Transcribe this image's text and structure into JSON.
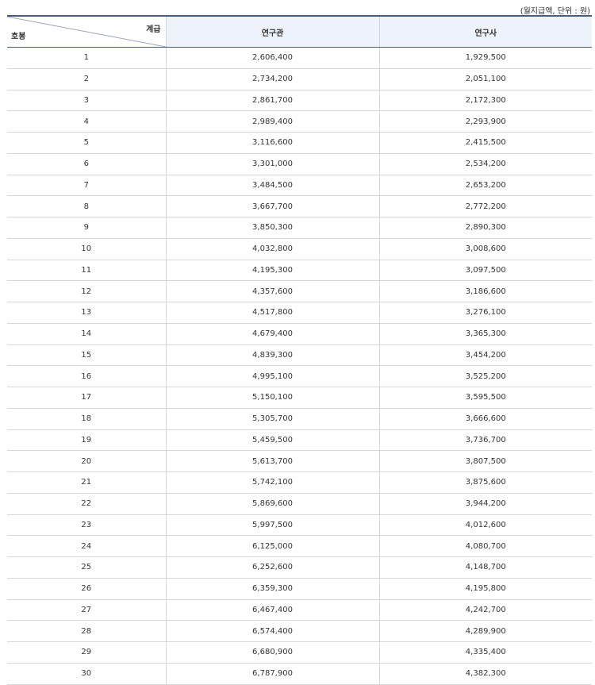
{
  "caption_fragment": "",
  "unit_note": "(월지급액, 단위 : 원)",
  "header": {
    "grade_label": "계급",
    "step_label": "호봉",
    "columns": [
      "연구관",
      "연구사"
    ]
  },
  "rows": [
    {
      "step": "1",
      "researcher_senior": "2,606,400",
      "researcher": "1,929,500"
    },
    {
      "step": "2",
      "researcher_senior": "2,734,200",
      "researcher": "2,051,100"
    },
    {
      "step": "3",
      "researcher_senior": "2,861,700",
      "researcher": "2,172,300"
    },
    {
      "step": "4",
      "researcher_senior": "2,989,400",
      "researcher": "2,293,900"
    },
    {
      "step": "5",
      "researcher_senior": "3,116,600",
      "researcher": "2,415,500"
    },
    {
      "step": "6",
      "researcher_senior": "3,301,000",
      "researcher": "2,534,200"
    },
    {
      "step": "7",
      "researcher_senior": "3,484,500",
      "researcher": "2,653,200"
    },
    {
      "step": "8",
      "researcher_senior": "3,667,700",
      "researcher": "2,772,200"
    },
    {
      "step": "9",
      "researcher_senior": "3,850,300",
      "researcher": "2,890,300"
    },
    {
      "step": "10",
      "researcher_senior": "4,032,800",
      "researcher": "3,008,600"
    },
    {
      "step": "11",
      "researcher_senior": "4,195,300",
      "researcher": "3,097,500"
    },
    {
      "step": "12",
      "researcher_senior": "4,357,600",
      "researcher": "3,186,600"
    },
    {
      "step": "13",
      "researcher_senior": "4,517,800",
      "researcher": "3,276,100"
    },
    {
      "step": "14",
      "researcher_senior": "4,679,400",
      "researcher": "3,365,300"
    },
    {
      "step": "15",
      "researcher_senior": "4,839,300",
      "researcher": "3,454,200"
    },
    {
      "step": "16",
      "researcher_senior": "4,995,100",
      "researcher": "3,525,200"
    },
    {
      "step": "17",
      "researcher_senior": "5,150,100",
      "researcher": "3,595,500"
    },
    {
      "step": "18",
      "researcher_senior": "5,305,700",
      "researcher": "3,666,600"
    },
    {
      "step": "19",
      "researcher_senior": "5,459,500",
      "researcher": "3,736,700"
    },
    {
      "step": "20",
      "researcher_senior": "5,613,700",
      "researcher": "3,807,500"
    },
    {
      "step": "21",
      "researcher_senior": "5,742,100",
      "researcher": "3,875,600"
    },
    {
      "step": "22",
      "researcher_senior": "5,869,600",
      "researcher": "3,944,200"
    },
    {
      "step": "23",
      "researcher_senior": "5,997,500",
      "researcher": "4,012,600"
    },
    {
      "step": "24",
      "researcher_senior": "6,125,000",
      "researcher": "4,080,700"
    },
    {
      "step": "25",
      "researcher_senior": "6,252,600",
      "researcher": "4,148,700"
    },
    {
      "step": "26",
      "researcher_senior": "6,359,300",
      "researcher": "4,195,800"
    },
    {
      "step": "27",
      "researcher_senior": "6,467,400",
      "researcher": "4,242,700"
    },
    {
      "step": "28",
      "researcher_senior": "6,574,400",
      "researcher": "4,289,900"
    },
    {
      "step": "29",
      "researcher_senior": "6,680,900",
      "researcher": "4,335,400"
    },
    {
      "step": "30",
      "researcher_senior": "6,787,900",
      "researcher": "4,382,300"
    }
  ]
}
